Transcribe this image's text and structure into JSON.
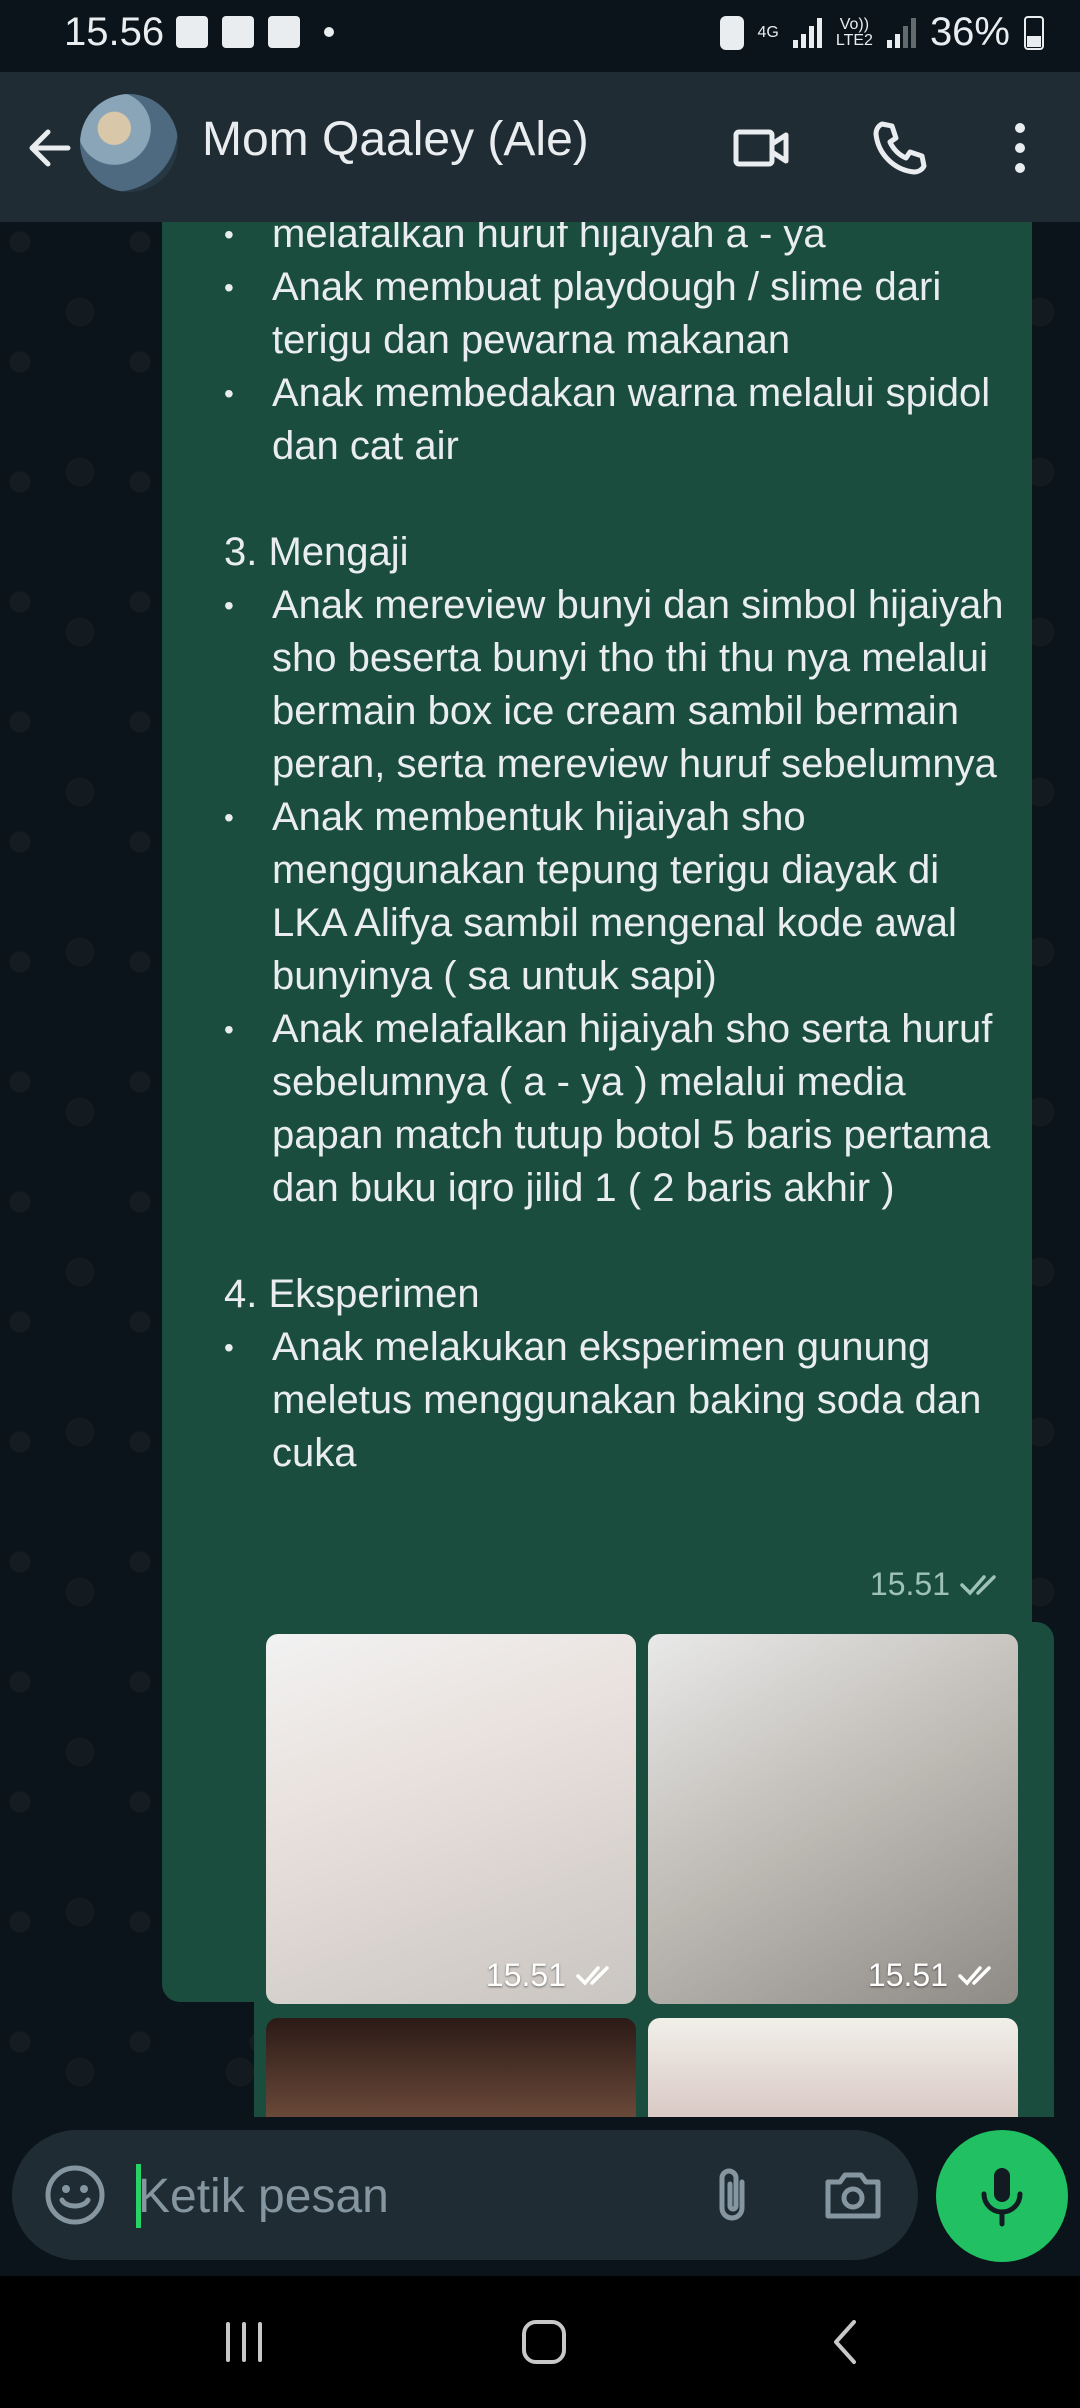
{
  "status_bar": {
    "time": "15.56",
    "network": "4G",
    "volte": "Vo))",
    "lte": "LTE2",
    "battery": "36%"
  },
  "header": {
    "contact_name": "Mom Qaaley (Ale)",
    "icons": [
      "back-arrow-icon",
      "video-call-icon",
      "phone-icon",
      "more-vert-icon"
    ]
  },
  "message": {
    "lines": {
      "l0": "melafalkan huruf hijaiyah a - ya",
      "l1": "Anak membuat playdough / slime dari terigu dan pewarna makanan",
      "l2": "Anak membedakan warna melalui spidol dan cat air",
      "h3": "3. Mengaji",
      "l3": "Anak mereview bunyi dan simbol hijaiyah sho beserta bunyi tho thi thu nya melalui bermain box ice cream sambil bermain peran, serta mereview huruf sebelumnya",
      "l4": "Anak membentuk hijaiyah sho menggunakan tepung terigu diayak di LKA Alifya sambil mengenal kode awal bunyinya ( sa untuk sapi)",
      "l5": "Anak melafalkan hijaiyah sho serta huruf sebelumnya ( a - ya ) melalui media papan match tutup botol   5 baris pertama dan buku iqro jilid 1 ( 2 baris akhir )",
      "h4": "4. Eksperimen",
      "l6": "Anak melakukan eksperimen gunung meletus menggunakan baking soda dan cuka"
    },
    "time": "15.51"
  },
  "media": {
    "photo1_time": "15.51",
    "photo2_time": "15.51"
  },
  "input": {
    "placeholder": "Ketik pesan"
  },
  "colors": {
    "bubble": "#1b4d3e",
    "accent": "#21c063",
    "header": "#1f2c34",
    "background": "#0b141a"
  }
}
